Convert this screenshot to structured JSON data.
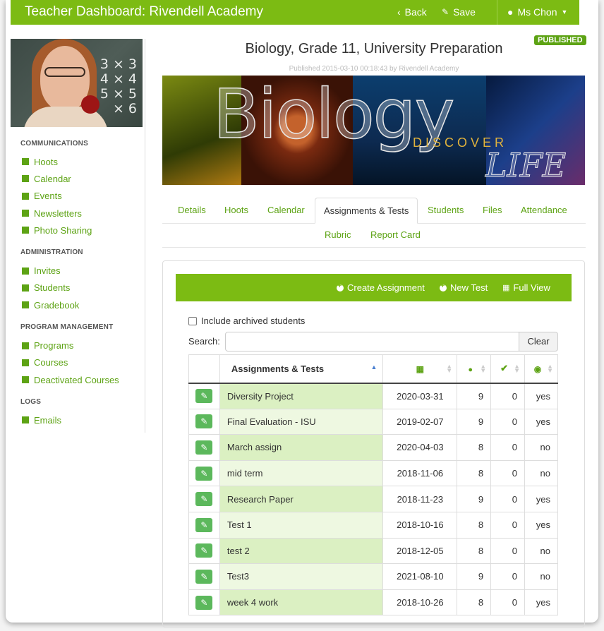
{
  "header": {
    "title": "Teacher Dashboard: Rivendell Academy",
    "back_label": "Back",
    "save_label": "Save",
    "user_label": "Ms Chon"
  },
  "sidebar": {
    "sections": [
      {
        "heading": "COMMUNICATIONS",
        "items": [
          {
            "label": "Hoots",
            "icon": "comment-icon"
          },
          {
            "label": "Calendar",
            "icon": "calendar-icon"
          },
          {
            "label": "Events",
            "icon": "tags-icon"
          },
          {
            "label": "Newsletters",
            "icon": "bookmark-icon"
          },
          {
            "label": "Photo Sharing",
            "icon": "picture-icon"
          }
        ]
      },
      {
        "heading": "ADMINISTRATION",
        "items": [
          {
            "label": "Invites",
            "icon": "envelope-icon"
          },
          {
            "label": "Students",
            "icon": "home-icon"
          },
          {
            "label": "Gradebook",
            "icon": "book-icon"
          }
        ]
      },
      {
        "heading": "PROGRAM MANAGEMENT",
        "items": [
          {
            "label": "Programs",
            "icon": "book-icon"
          },
          {
            "label": "Courses",
            "icon": "folder-icon"
          },
          {
            "label": "Deactivated Courses",
            "icon": "folder-icon"
          }
        ]
      },
      {
        "heading": "LOGS",
        "items": [
          {
            "label": "Emails",
            "icon": "book-icon"
          }
        ]
      }
    ],
    "photo_math": [
      "3 × 3",
      "4 × 4",
      "5 × 5",
      "× 6"
    ]
  },
  "course": {
    "title": "Biology, Grade 11, University Preparation",
    "status_badge": "PUBLISHED",
    "published_info": "Published 2015-03-10 00:18:43 by Rivendell Academy",
    "banner_word": "Biology",
    "banner_discover": "DISCOVER",
    "banner_life": "LIFE"
  },
  "tabs": [
    {
      "label": "Details",
      "active": false
    },
    {
      "label": "Hoots",
      "active": false
    },
    {
      "label": "Calendar",
      "active": false
    },
    {
      "label": "Assignments & Tests",
      "active": true
    },
    {
      "label": "Students",
      "active": false
    },
    {
      "label": "Files",
      "active": false
    },
    {
      "label": "Attendance",
      "active": false
    },
    {
      "label": "Rubric",
      "active": false
    },
    {
      "label": "Report Card",
      "active": false
    }
  ],
  "actions": {
    "create_assignment": "Create Assignment",
    "new_test": "New Test",
    "full_view": "Full View"
  },
  "filters": {
    "include_archived_label": "Include archived students",
    "include_archived_checked": false,
    "search_label": "Search:",
    "search_value": "",
    "clear_label": "Clear"
  },
  "table": {
    "header": "Assignments & Tests",
    "header_icons": [
      "calendar-icon",
      "user-icon",
      "check-icon",
      "globe-icon"
    ],
    "rows": [
      {
        "name": "Diversity Project",
        "date": "2020-03-31",
        "students": "9",
        "done": "0",
        "published": "yes"
      },
      {
        "name": "Final Evaluation - ISU",
        "date": "2019-02-07",
        "students": "9",
        "done": "0",
        "published": "yes"
      },
      {
        "name": "March assign",
        "date": "2020-04-03",
        "students": "8",
        "done": "0",
        "published": "no"
      },
      {
        "name": "mid term",
        "date": "2018-11-06",
        "students": "8",
        "done": "0",
        "published": "no"
      },
      {
        "name": "Research Paper",
        "date": "2018-11-23",
        "students": "9",
        "done": "0",
        "published": "yes"
      },
      {
        "name": "Test 1",
        "date": "2018-10-16",
        "students": "8",
        "done": "0",
        "published": "yes"
      },
      {
        "name": "test 2",
        "date": "2018-12-05",
        "students": "8",
        "done": "0",
        "published": "no"
      },
      {
        "name": "Test3",
        "date": "2021-08-10",
        "students": "9",
        "done": "0",
        "published": "no"
      },
      {
        "name": "week 4 work",
        "date": "2018-10-26",
        "students": "8",
        "done": "0",
        "published": "yes"
      }
    ]
  },
  "colors": {
    "brand": "#7cbb13",
    "link": "#5da314",
    "edit_button": "#5cb85c"
  }
}
